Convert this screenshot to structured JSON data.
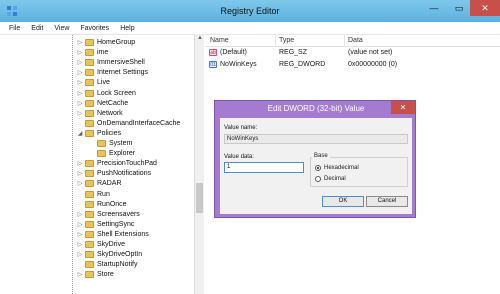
{
  "window": {
    "title": "Registry Editor",
    "min_glyph": "—",
    "max_glyph": "▭",
    "close_glyph": "✕"
  },
  "menu": [
    "File",
    "Edit",
    "View",
    "Favorites",
    "Help"
  ],
  "tree": {
    "items": [
      {
        "label": "HomeGroup",
        "level": 0,
        "expand": "▷"
      },
      {
        "label": "ime",
        "level": 0,
        "expand": "▷"
      },
      {
        "label": "ImmersiveShell",
        "level": 0,
        "expand": "▷"
      },
      {
        "label": "Internet Settings",
        "level": 0,
        "expand": "▷"
      },
      {
        "label": "Live",
        "level": 0,
        "expand": "▷"
      },
      {
        "label": "Lock Screen",
        "level": 0,
        "expand": "▷"
      },
      {
        "label": "NetCache",
        "level": 0,
        "expand": "▷"
      },
      {
        "label": "Network",
        "level": 0,
        "expand": "▷"
      },
      {
        "label": "OnDemandInterfaceCache",
        "level": 0,
        "expand": ""
      },
      {
        "label": "Policies",
        "level": 0,
        "expand": "◢"
      },
      {
        "label": "System",
        "level": 1,
        "expand": ""
      },
      {
        "label": "Explorer",
        "level": 1,
        "expand": ""
      },
      {
        "label": "PrecisionTouchPad",
        "level": 0,
        "expand": "▷"
      },
      {
        "label": "PushNotifications",
        "level": 0,
        "expand": "▷"
      },
      {
        "label": "RADAR",
        "level": 0,
        "expand": "▷"
      },
      {
        "label": "Run",
        "level": 0,
        "expand": ""
      },
      {
        "label": "RunOnce",
        "level": 0,
        "expand": ""
      },
      {
        "label": "Screensavers",
        "level": 0,
        "expand": "▷"
      },
      {
        "label": "SettingSync",
        "level": 0,
        "expand": "▷"
      },
      {
        "label": "Shell Extensions",
        "level": 0,
        "expand": "▷"
      },
      {
        "label": "SkyDrive",
        "level": 0,
        "expand": "▷"
      },
      {
        "label": "SkyDriveOptIn",
        "level": 0,
        "expand": "▷"
      },
      {
        "label": "StartupNotify",
        "level": 0,
        "expand": ""
      },
      {
        "label": "Store",
        "level": 0,
        "expand": "▷"
      }
    ]
  },
  "list": {
    "columns": {
      "name": "Name",
      "type": "Type",
      "data": "Data"
    },
    "rows": [
      {
        "name": "(Default)",
        "type": "REG_SZ",
        "data": "(value not set)",
        "icon": "string-value-icon",
        "icon_text": "ab"
      },
      {
        "name": "NoWinKeys",
        "type": "REG_DWORD",
        "data": "0x00000000 (0)",
        "icon": "dword-value-icon",
        "icon_text": "01"
      }
    ]
  },
  "dialog": {
    "title": "Edit DWORD (32-bit) Value",
    "close_glyph": "✕",
    "value_name_label": "Value name:",
    "value_name": "NoWinKeys",
    "value_data_label": "Value data:",
    "value_data": "1",
    "base_label": "Base",
    "radio_hex": "Hexadecimal",
    "radio_dec": "Decimal",
    "selected_base": "Hexadecimal",
    "ok_label": "OK",
    "cancel_label": "Cancel"
  },
  "colors": {
    "titlebar": "#5bb2df",
    "dialog_frame": "#a57ad1",
    "close_button": "#c7504a"
  }
}
